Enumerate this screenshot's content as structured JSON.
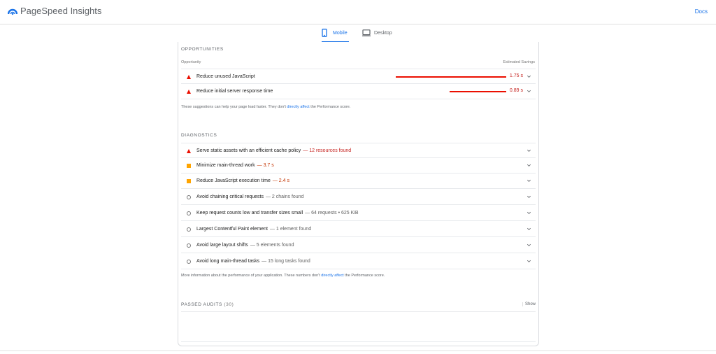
{
  "header": {
    "brand": "PageSpeed Insights",
    "docs_link": "Docs"
  },
  "tabs": [
    {
      "label": "Mobile",
      "icon": "mobile-phone-icon",
      "active": true
    },
    {
      "label": "Desktop",
      "icon": "desktop-monitor-icon",
      "active": false
    }
  ],
  "colors": {
    "accent": "#1a73e8",
    "fail": "#eb0f00",
    "average": "#ffa400",
    "info": "#757575"
  },
  "opportunities": {
    "title": "OPPORTUNITIES",
    "col_left": "Opportunity",
    "col_right": "Estimated Savings",
    "items": [
      {
        "title": "Reduce unused JavaScript",
        "savings": "1.75 s",
        "bar_fraction": 1.0,
        "status": "fail"
      },
      {
        "title": "Reduce initial server response time",
        "savings": "0.89 s",
        "bar_fraction": 0.51,
        "status": "fail"
      }
    ],
    "note_before": "These suggestions can help your page load faster. They don't",
    "note_link": "directly affect",
    "note_after": "the Performance score."
  },
  "diagnostics": {
    "title": "DIAGNOSTICS",
    "items": [
      {
        "title": "Serve static assets with an efficient cache policy",
        "value": "— 12 resources found",
        "status": "fail"
      },
      {
        "title": "Minimize main-thread work",
        "value": "— 3.7 s",
        "status": "average"
      },
      {
        "title": "Reduce JavaScript execution time",
        "value": "— 2.4 s",
        "status": "average"
      },
      {
        "title": "Avoid chaining critical requests",
        "value": "— 2 chains found",
        "status": "info"
      },
      {
        "title": "Keep request counts low and transfer sizes small",
        "value": "— 64 requests • 625 KiB",
        "status": "info"
      },
      {
        "title": "Largest Contentful Paint element",
        "value": "— 1 element found",
        "status": "info"
      },
      {
        "title": "Avoid large layout shifts",
        "value": "— 5 elements found",
        "status": "info"
      },
      {
        "title": "Avoid long main-thread tasks",
        "value": "— 15 long tasks found",
        "status": "info"
      }
    ],
    "note_before": "More information about the performance of your application. These numbers don't",
    "note_link": "directly affect",
    "note_after": "the Performance score."
  },
  "passed": {
    "title": "PASSED AUDITS",
    "count": "(30)",
    "show_label": "Show"
  }
}
